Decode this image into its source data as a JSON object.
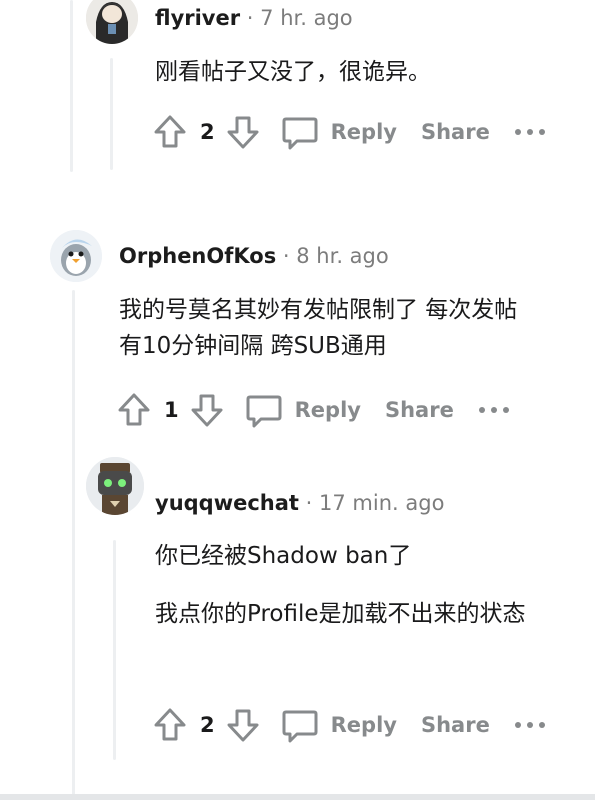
{
  "comments": [
    {
      "username": "flyriver",
      "separator": "·",
      "time": "7 hr. ago",
      "body": [
        "刚看帖子又没了，很诡异。"
      ],
      "votes": "2",
      "reply_label": "Reply",
      "share_label": "Share"
    },
    {
      "username": "OrphenOfKos",
      "separator": "·",
      "time": "8 hr. ago",
      "body": [
        "我的号莫名其妙有发帖限制了 每次发帖有10分钟间隔 跨SUB通用"
      ],
      "votes": "1",
      "reply_label": "Reply",
      "share_label": "Share"
    },
    {
      "username": "yuqqwechat",
      "separator": "·",
      "time": "17 min. ago",
      "body": [
        "你已经被Shadow ban了",
        "我点你的Profile是加载不出来的状态"
      ],
      "votes": "2",
      "reply_label": "Reply",
      "share_label": "Share"
    }
  ],
  "icons": {
    "upvote": "arrow-up-icon",
    "downvote": "arrow-down-icon",
    "reply": "speech-bubble-icon",
    "more": "more-dots-icon"
  },
  "colors": {
    "text": "#1a1a1b",
    "muted": "#878a8c",
    "thread_line": "#edeff1"
  }
}
